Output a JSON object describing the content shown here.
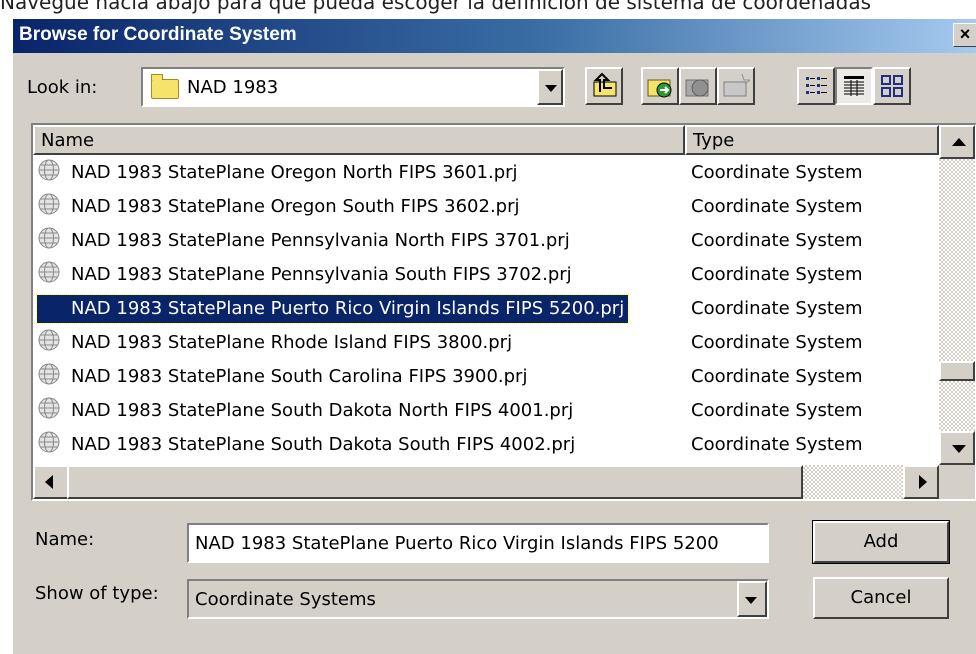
{
  "caption": "Navegue hacia abajo para que pueda escoger la definición de sistema de coordenadas",
  "dialog": {
    "title": "Browse for Coordinate System",
    "close_glyph": "×"
  },
  "look_in": {
    "label": "Look in:",
    "value": "NAD 1983",
    "folder_icon": "folder-icon"
  },
  "toolbar": {
    "icons": [
      "up-one-level-icon",
      "connect-folder-icon",
      "disconnect-folder-icon",
      "new-folder-icon",
      "list-view-icon",
      "details-view-icon",
      "thumbnails-view-icon"
    ]
  },
  "list": {
    "columns": [
      "Name",
      "Type"
    ],
    "rows": [
      {
        "name": "NAD 1983 StatePlane Oregon North FIPS 3601.prj",
        "type": "Coordinate System"
      },
      {
        "name": "NAD 1983 StatePlane Oregon South FIPS 3602.prj",
        "type": "Coordinate System"
      },
      {
        "name": "NAD 1983 StatePlane Pennsylvania North FIPS 3701.prj",
        "type": "Coordinate System"
      },
      {
        "name": "NAD 1983 StatePlane Pennsylvania South FIPS 3702.prj",
        "type": "Coordinate System"
      },
      {
        "name": "NAD 1983 StatePlane Puerto Rico Virgin Islands FIPS 5200.prj",
        "type": "Coordinate System",
        "selected": true
      },
      {
        "name": "NAD 1983 StatePlane Rhode Island FIPS 3800.prj",
        "type": "Coordinate System"
      },
      {
        "name": "NAD 1983 StatePlane South Carolina FIPS 3900.prj",
        "type": "Coordinate System"
      },
      {
        "name": "NAD 1983 StatePlane South Dakota North FIPS 4001.prj",
        "type": "Coordinate System"
      },
      {
        "name": "NAD 1983 StatePlane South Dakota South FIPS 4002.prj",
        "type": "Coordinate System"
      }
    ],
    "selected_color": "#0a246a"
  },
  "name_field": {
    "label": "Name:",
    "value": "NAD 1983 StatePlane Puerto Rico Virgin Islands FIPS 5200"
  },
  "type_field": {
    "label": "Show of type:",
    "value": "Coordinate Systems"
  },
  "buttons": {
    "add": "Add",
    "cancel": "Cancel"
  },
  "colors": {
    "title_start": "#0a246a",
    "title_end": "#a6caf0",
    "face": "#d4d0c8"
  }
}
